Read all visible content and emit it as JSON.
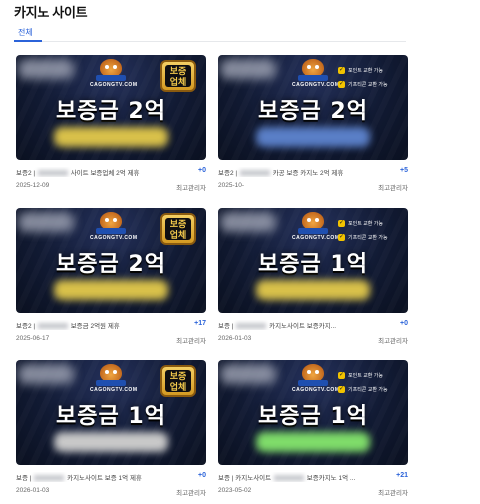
{
  "page_title": "카지노 사이트",
  "tabs": [
    {
      "label": "전체",
      "active": true
    }
  ],
  "colors": {
    "accent": "#2b63d9",
    "thumb_dark": "#111a33",
    "badge_gold": "#f2c94c"
  },
  "posts": [
    {
      "thumb_style": "badge",
      "headline": "보증금 2억",
      "site_mark": "CAGONGTV.COM",
      "badge_text": "보증 업체",
      "blur_color": "#d9c14a",
      "title_prefix": "보증2 |",
      "title_suffix": "사이트 보증업체 2억 제휴",
      "comments": "+0",
      "date": "2025-12-09",
      "author": "최고관리자"
    },
    {
      "thumb_style": "checks",
      "headline": "보증금 2억",
      "site_mark": "CAGONGTV.COM",
      "check_labels": [
        "포인트 교환 가능",
        "기프티콘 교환 가능"
      ],
      "blur_color": "#5a7fc7",
      "title_prefix": "보증2 |",
      "title_suffix": "카공 보증 카지노 2억 제휴",
      "comments": "+5",
      "date": "2025-10-",
      "author": "최고관리자"
    },
    {
      "thumb_style": "badge",
      "headline": "보증금 2억",
      "site_mark": "CAGONGTV.COM",
      "badge_text": "보증 업체",
      "blur_color": "#d9c14a",
      "title_prefix": "보증2 |",
      "title_suffix": "보증금 2억원 제휴",
      "comments": "+17",
      "date": "2025-06-17",
      "author": "최고관리자"
    },
    {
      "thumb_style": "checks",
      "headline": "보증금 1억",
      "site_mark": "CAGONGTV.COM",
      "check_labels": [
        "포인트 교환 가능",
        "기프티콘 교환 가능"
      ],
      "blur_color": "#d9c14a",
      "title_prefix": "보증 |",
      "title_suffix": "카지노사이트 보증카지...",
      "comments": "+0",
      "date": "2026-01-03",
      "author": "최고관리자"
    },
    {
      "thumb_style": "badge",
      "headline": "보증금 1억",
      "site_mark": "CAGONGTV.COM",
      "badge_text": "보증 업체",
      "blur_color": "#c9c9c9",
      "title_prefix": "보증 |",
      "title_suffix": "카지노사이트 보증 1억 제휴",
      "comments": "+0",
      "date": "2026-01-03",
      "author": "최고관리자"
    },
    {
      "thumb_style": "checks",
      "headline": "보증금 1억",
      "site_mark": "CAGONGTV.COM",
      "check_labels": [
        "포인트 교환 가능",
        "기프티콘 교환 가능"
      ],
      "blur_color": "#7fdc6a",
      "title_prefix": "보증 | 카지노사이트",
      "title_suffix": "보증카지노 1억 ...",
      "comments": "+21",
      "date": "2023-05-02",
      "author": "최고관리자"
    }
  ]
}
